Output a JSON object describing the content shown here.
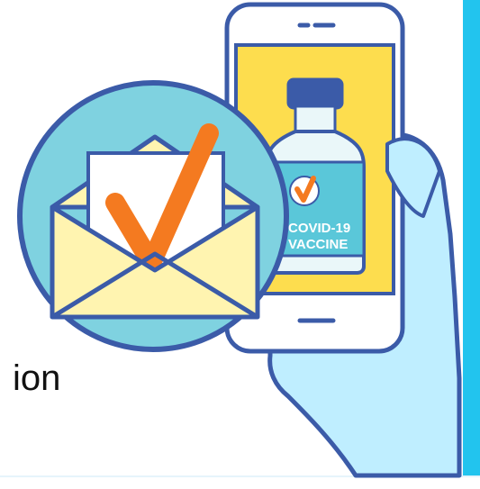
{
  "illustration": {
    "partial_text": "ion",
    "vaccine_label_line1": "COVID-19",
    "vaccine_label_line2": "VACCINE",
    "icons": [
      "smartphone-icon",
      "vaccine-bottle-icon",
      "hand-icon",
      "envelope-icon",
      "checkmark-icon"
    ]
  },
  "colors": {
    "accent_bar": "#22c4ee",
    "outline": "#3b5ba8",
    "phone_screen": "#fddd4e",
    "bottle_cap": "#3b5ba8",
    "bottle_label": "#5ac7d9",
    "hand": "#bfeeff",
    "circle_badge": "#7fd2e0",
    "envelope": "#fff4b0",
    "checkmark": "#f47a20"
  }
}
